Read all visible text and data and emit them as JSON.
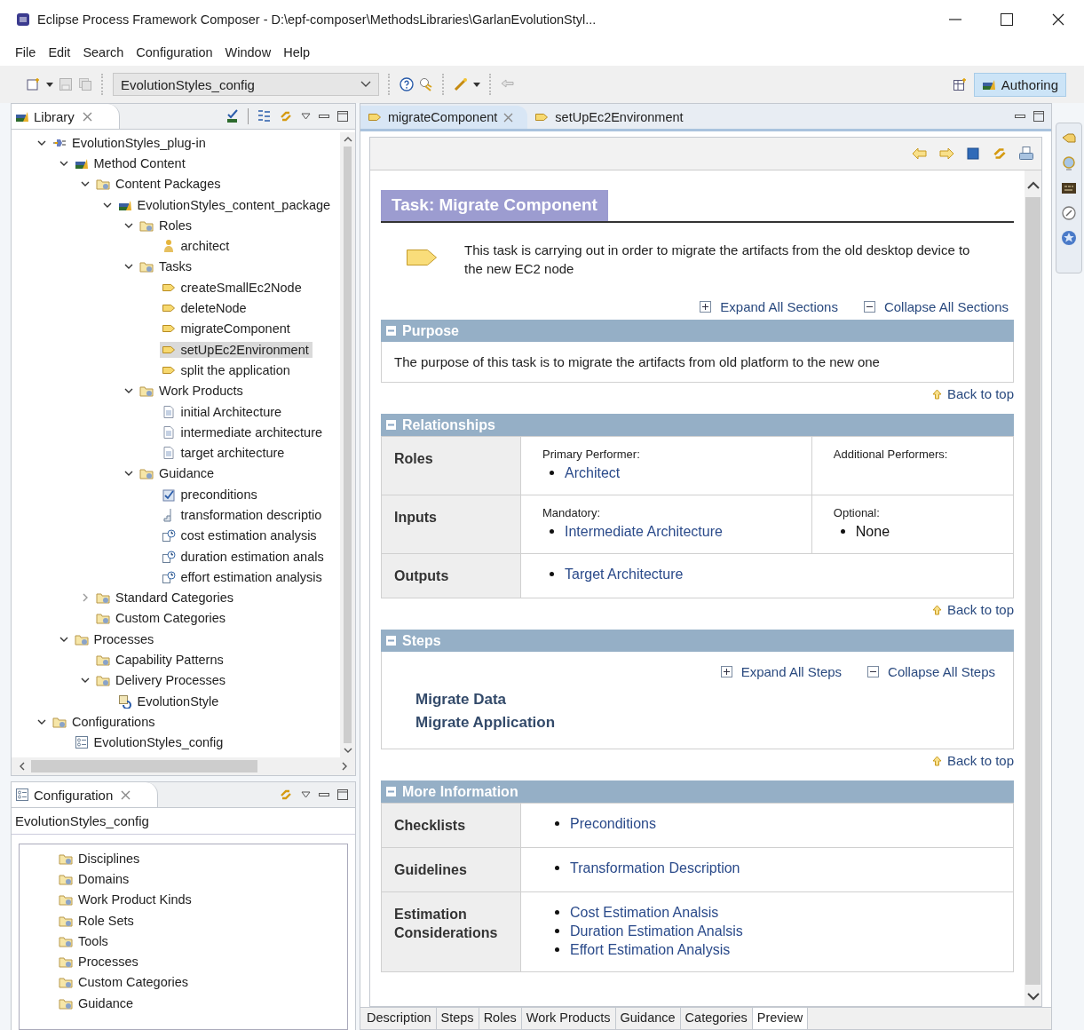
{
  "window": {
    "title": "Eclipse Process Framework Composer - D:\\epf-composer\\MethodsLibraries\\GarlanEvolutionStyl..."
  },
  "menu": [
    "File",
    "Edit",
    "Search",
    "Configuration",
    "Window",
    "Help"
  ],
  "toolbar": {
    "config_combo": {
      "value": "EvolutionStyles_config"
    },
    "perspective": {
      "label": "Authoring",
      "selected": true
    }
  },
  "library_view": {
    "title": "Library",
    "tree": [
      {
        "label": "EvolutionStyles_plug-in",
        "kind": "plugin",
        "expanded": true,
        "selected": false,
        "children": [
          {
            "label": "Method Content",
            "kind": "content",
            "expanded": true,
            "selected": false,
            "children": [
              {
                "label": "Content Packages",
                "kind": "folder",
                "expanded": true,
                "selected": false,
                "children": [
                  {
                    "label": "EvolutionStyles_content_package",
                    "kind": "content",
                    "expanded": true,
                    "selected": false,
                    "children": [
                      {
                        "label": "Roles",
                        "kind": "folder",
                        "expanded": true,
                        "selected": false,
                        "children": [
                          {
                            "label": "architect",
                            "kind": "role",
                            "selected": false
                          }
                        ]
                      },
                      {
                        "label": "Tasks",
                        "kind": "folder",
                        "expanded": true,
                        "selected": false,
                        "children": [
                          {
                            "label": "createSmallEc2Node",
                            "kind": "task",
                            "selected": false
                          },
                          {
                            "label": "deleteNode",
                            "kind": "task",
                            "selected": false
                          },
                          {
                            "label": "migrateComponent",
                            "kind": "task",
                            "selected": false
                          },
                          {
                            "label": "setUpEc2Environment",
                            "kind": "task",
                            "selected": true
                          },
                          {
                            "label": "split the application",
                            "kind": "task",
                            "selected": false
                          }
                        ]
                      },
                      {
                        "label": "Work Products",
                        "kind": "folder",
                        "expanded": true,
                        "selected": false,
                        "children": [
                          {
                            "label": "initial Architecture",
                            "kind": "artifact",
                            "selected": false
                          },
                          {
                            "label": "intermediate architecture",
                            "kind": "artifact",
                            "selected": false
                          },
                          {
                            "label": "target architecture",
                            "kind": "artifact",
                            "selected": false
                          }
                        ]
                      },
                      {
                        "label": "Guidance",
                        "kind": "folder",
                        "expanded": true,
                        "selected": false,
                        "children": [
                          {
                            "label": "preconditions",
                            "kind": "checklist",
                            "selected": false
                          },
                          {
                            "label": "transformation descriptio",
                            "kind": "guideline",
                            "selected": false
                          },
                          {
                            "label": "cost estimation analysis",
                            "kind": "estimate",
                            "selected": false
                          },
                          {
                            "label": "duration estimation anals",
                            "kind": "estimate",
                            "selected": false
                          },
                          {
                            "label": "effort estimation analysis",
                            "kind": "estimate",
                            "selected": false
                          }
                        ]
                      }
                    ]
                  }
                ]
              },
              {
                "label": "Standard Categories",
                "kind": "folder",
                "expanded": false,
                "selected": false
              },
              {
                "label": "Custom Categories",
                "kind": "folder",
                "selected": false
              }
            ]
          },
          {
            "label": "Processes",
            "kind": "folder",
            "expanded": true,
            "selected": false,
            "children": [
              {
                "label": "Capability Patterns",
                "kind": "folder",
                "selected": false
              },
              {
                "label": "Delivery Processes",
                "kind": "folder",
                "expanded": true,
                "selected": false,
                "children": [
                  {
                    "label": "EvolutionStyle",
                    "kind": "process",
                    "selected": false
                  }
                ]
              }
            ]
          }
        ]
      },
      {
        "label": "Configurations",
        "kind": "folder",
        "expanded": true,
        "selected": false,
        "children": [
          {
            "label": "EvolutionStyles_config",
            "kind": "config",
            "selected": false
          }
        ]
      }
    ]
  },
  "configuration_view": {
    "title": "Configuration",
    "config_name": "EvolutionStyles_config",
    "items": [
      "Disciplines",
      "Domains",
      "Work Product Kinds",
      "Role Sets",
      "Tools",
      "Processes",
      "Custom Categories",
      "Guidance"
    ]
  },
  "editor": {
    "tabs": [
      {
        "label": "migrateComponent",
        "selected": true
      },
      {
        "label": "setUpEc2Environment",
        "selected": false
      }
    ],
    "page": {
      "title": "Task: Migrate Component",
      "description": "This task is carrying out in order to migrate the artifacts from the old desktop device to the new EC2 node",
      "expand_all": "Expand All Sections",
      "collapse_all": "Collapse All Sections",
      "sections": [
        {
          "kind": "text",
          "title": "Purpose",
          "text": "The purpose of this task is to migrate the artifacts from old platform to the new one",
          "back_to_top": "Back to top"
        },
        {
          "kind": "table",
          "title": "Relationships",
          "rows": [
            {
              "label": "Roles",
              "cells": [
                {
                  "caption": "Primary Performer:",
                  "items": [
                    {
                      "text": "Architect",
                      "link": true
                    }
                  ]
                },
                {
                  "caption": "Additional Performers:"
                }
              ]
            },
            {
              "label": "Inputs",
              "cells": [
                {
                  "caption": "Mandatory:",
                  "items": [
                    {
                      "text": "Intermediate Architecture",
                      "link": true
                    }
                  ]
                },
                {
                  "caption": "Optional:",
                  "items": [
                    {
                      "text": "None",
                      "link": false
                    }
                  ]
                }
              ]
            },
            {
              "label": "Outputs",
              "cells": [
                {
                  "colspan": 2,
                  "items": [
                    {
                      "text": "Target Architecture",
                      "link": true
                    }
                  ]
                }
              ]
            }
          ],
          "back_to_top": "Back to top"
        },
        {
          "kind": "steps",
          "title": "Steps",
          "expand_all": "Expand All Steps",
          "collapse_all": "Collapse All Steps",
          "steps": [
            "Migrate Data",
            "Migrate Application"
          ],
          "back_to_top": "Back to top"
        },
        {
          "kind": "table",
          "title": "More Information",
          "rows": [
            {
              "label": "Checklists",
              "cells": [
                {
                  "items": [
                    {
                      "text": "Preconditions",
                      "link": true
                    }
                  ]
                }
              ]
            },
            {
              "label": "Guidelines",
              "cells": [
                {
                  "items": [
                    {
                      "text": "Transformation Description",
                      "link": true
                    }
                  ]
                }
              ]
            },
            {
              "label": "Estimation Considerations",
              "cells": [
                {
                  "items": [
                    {
                      "text": "Cost Estimation Analsis",
                      "link": true
                    },
                    {
                      "text": "Duration Estimation Analsis",
                      "link": true
                    },
                    {
                      "text": "Effort Estimation Analysis",
                      "link": true
                    }
                  ]
                }
              ]
            }
          ]
        }
      ]
    },
    "bottom_tabs": [
      {
        "label": "Description",
        "selected": false
      },
      {
        "label": "Steps",
        "selected": false
      },
      {
        "label": "Roles",
        "selected": false
      },
      {
        "label": "Work Products",
        "selected": false
      },
      {
        "label": "Guidance",
        "selected": false
      },
      {
        "label": "Categories",
        "selected": false
      },
      {
        "label": "Preview",
        "selected": true
      }
    ]
  }
}
